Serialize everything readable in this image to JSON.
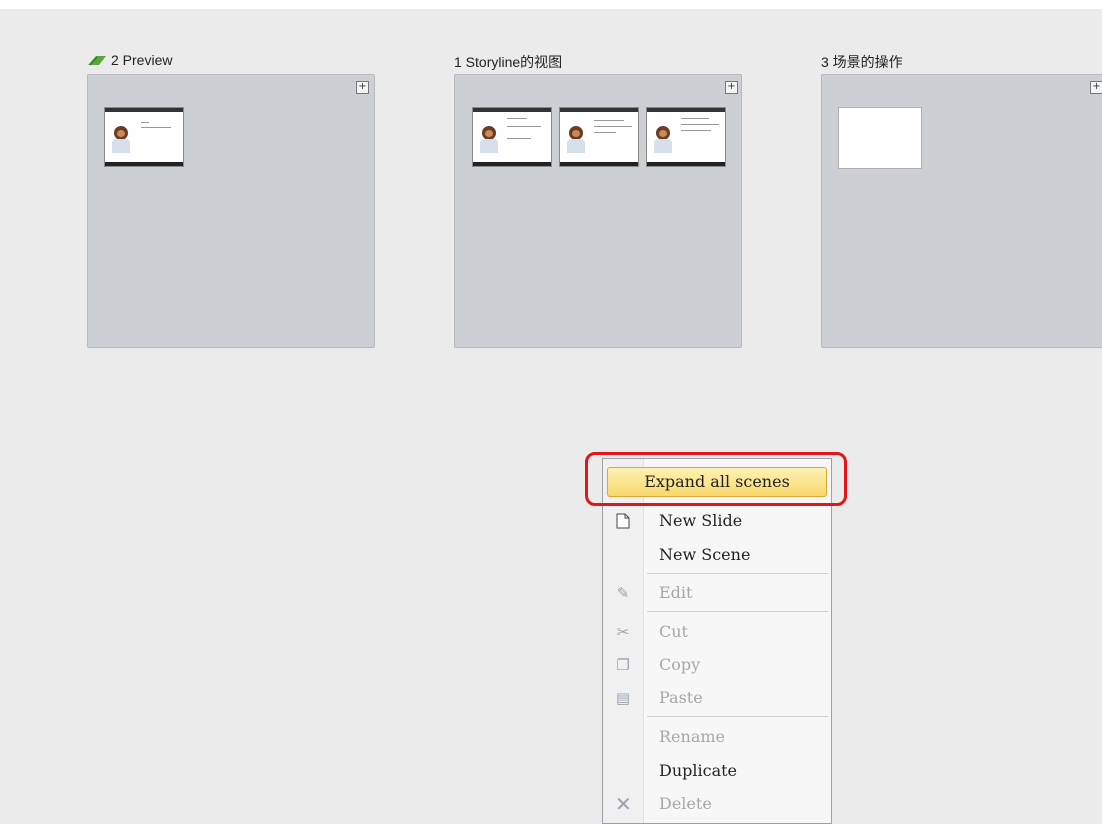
{
  "scenes": [
    {
      "title": "2 Preview",
      "has_flag": true,
      "plus": "+"
    },
    {
      "title": "1  Storyline的视图",
      "has_flag": false,
      "plus": "+"
    },
    {
      "title": "3 场景的操作",
      "has_flag": false,
      "plus": "+"
    }
  ],
  "context_menu": {
    "highlighted": "Expand all scenes",
    "items": [
      {
        "label": "New Slide",
        "enabled": true,
        "icon": "new-slide-icon"
      },
      {
        "label": "New Scene",
        "enabled": true,
        "icon": ""
      },
      {
        "label": "Edit",
        "enabled": false,
        "icon": "edit-icon"
      },
      {
        "label": "Cut",
        "enabled": false,
        "icon": "cut-icon"
      },
      {
        "label": "Copy",
        "enabled": false,
        "icon": "copy-icon"
      },
      {
        "label": "Paste",
        "enabled": false,
        "icon": "paste-icon"
      },
      {
        "label": "Rename",
        "enabled": false,
        "icon": ""
      },
      {
        "label": "Duplicate",
        "enabled": true,
        "icon": ""
      },
      {
        "label": "Delete",
        "enabled": false,
        "icon": "delete-icon"
      }
    ]
  },
  "colors": {
    "highlight_frame": "#e4151a",
    "scene_panel": "#ccd0d5",
    "start_flag": "#5aa83c"
  }
}
